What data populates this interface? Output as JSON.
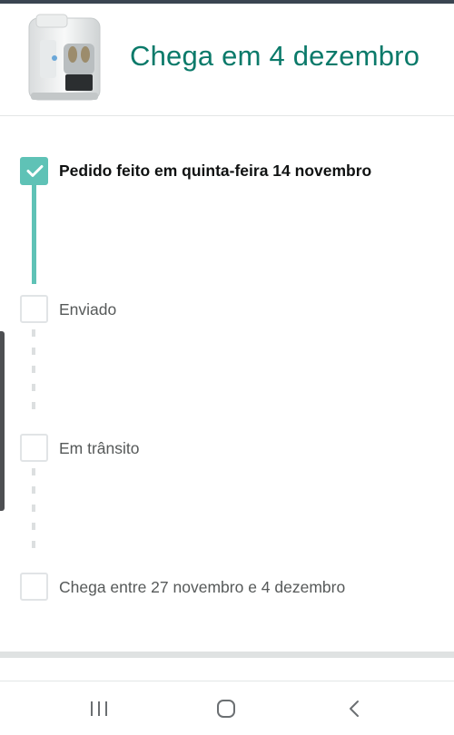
{
  "header": {
    "product_image": "water-purifier",
    "arrival_title": "Chega em 4 dezembro"
  },
  "timeline": {
    "steps": [
      {
        "label": "Pedido feito em quinta-feira 14 novembro",
        "done": true
      },
      {
        "label": "Enviado",
        "done": false
      },
      {
        "label": "Em trânsito",
        "done": false
      },
      {
        "label": "Chega entre 27 novembro e 4 dezembro",
        "done": false
      }
    ],
    "progress_fraction": 0.33
  },
  "nav": {
    "buttons": [
      "recent-apps-icon",
      "home-icon",
      "back-icon"
    ]
  },
  "colors": {
    "accent": "#0b7a6a",
    "progress": "#5fc2b6",
    "pending": "#e1e4e6",
    "text_done": "#0f1111",
    "text_pending": "#565959"
  }
}
